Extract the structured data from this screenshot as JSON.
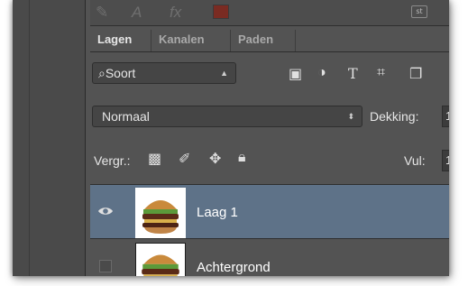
{
  "tabs": [
    "Lagen",
    "Kanalen",
    "Paden"
  ],
  "toolbar": {
    "swatch_color": "#7a2b22",
    "right_icon_label": "st"
  },
  "filter": {
    "selected": "Soort",
    "icons": [
      "image-filter-icon",
      "adjustment-filter-icon",
      "type-filter-icon",
      "shape-filter-icon",
      "smart-object-filter-icon"
    ]
  },
  "blend": {
    "mode": "Normaal",
    "opacity_label": "Dekking:",
    "opacity_value": "1"
  },
  "locks": {
    "label": "Vergr.:",
    "icons": [
      "lock-transparent-icon",
      "lock-paint-icon",
      "lock-position-icon",
      "lock-all-icon"
    ],
    "fill_label": "Vul:",
    "fill_value": "1"
  },
  "layers": [
    {
      "name": "Laag 1",
      "visible": true,
      "selected": true
    },
    {
      "name": "Achtergrond",
      "visible": false,
      "selected": false
    }
  ],
  "colors": {
    "panel": "#535353",
    "selected_layer": "#5e7288"
  }
}
